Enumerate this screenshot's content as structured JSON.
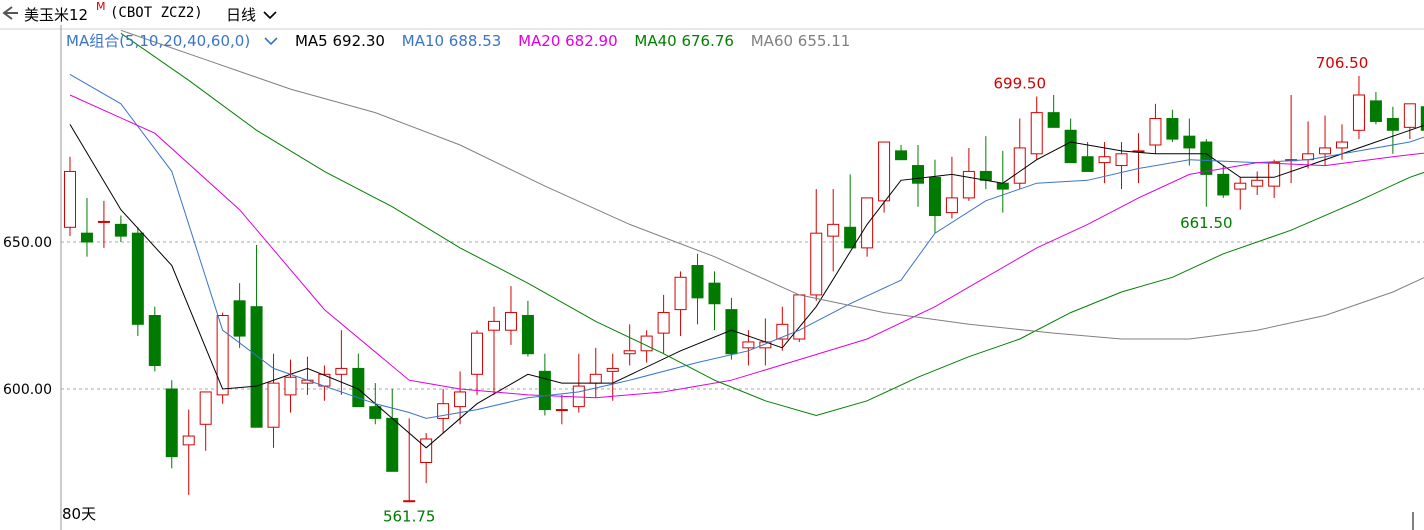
{
  "header": {
    "instrument": "美玉米12",
    "badge": "M",
    "code": "(CBOT ZCZ2)",
    "period": "日线"
  },
  "ma_legend": {
    "group_label": "MA组合(5,10,20,40,60,0)",
    "items": [
      {
        "label": "MA5 692.30",
        "color": "#000000"
      },
      {
        "label": "MA10 688.53",
        "color": "#3a74c9"
      },
      {
        "label": "MA20 682.90",
        "color": "#e000e0"
      },
      {
        "label": "MA40 676.76",
        "color": "#008000"
      },
      {
        "label": "MA60 655.11",
        "color": "#808080"
      }
    ]
  },
  "colors": {
    "up": "#d40000",
    "down": "#007a00",
    "grid": "#aaaaaa",
    "group": "#3a74c9"
  },
  "chart_data": {
    "type": "candlestick",
    "ylim": [
      548,
      715
    ],
    "yticks": [
      600.0,
      650.0
    ],
    "ytick_labels": [
      "600.00",
      "650.00"
    ],
    "days_label": "80天",
    "annotations": [
      {
        "text": "561.75",
        "index": 20,
        "value": 561.75,
        "position": "below",
        "color": "#007a00"
      },
      {
        "text": "699.50",
        "index": 56,
        "value": 699.5,
        "position": "above",
        "color": "#d40000"
      },
      {
        "text": "661.50",
        "index": 67,
        "value": 661.5,
        "position": "below",
        "color": "#007a00"
      },
      {
        "text": "706.50",
        "index": 75,
        "value": 706.5,
        "position": "above",
        "color": "#d40000"
      }
    ],
    "ohlc": [
      [
        655,
        679,
        652,
        674
      ],
      [
        653,
        665,
        645,
        650
      ],
      [
        657,
        664,
        648,
        657
      ],
      [
        656,
        659,
        650,
        652
      ],
      [
        653,
        655,
        618,
        622
      ],
      [
        625,
        628,
        606,
        608
      ],
      [
        600,
        603,
        573,
        577
      ],
      [
        581,
        593,
        564,
        584
      ],
      [
        588,
        598,
        579,
        599
      ],
      [
        598,
        626,
        595,
        625
      ],
      [
        630,
        636,
        614,
        618
      ],
      [
        628,
        649,
        602,
        587
      ],
      [
        587,
        612,
        580,
        602
      ],
      [
        598,
        610,
        592,
        604
      ],
      [
        602,
        611,
        598,
        603
      ],
      [
        601,
        608,
        596,
        605
      ],
      [
        605,
        620,
        598,
        607
      ],
      [
        607,
        612,
        596,
        594
      ],
      [
        594,
        602,
        588,
        590
      ],
      [
        590,
        600,
        580,
        572
      ],
      [
        562,
        590,
        562,
        562
      ],
      [
        575,
        585,
        568,
        583
      ],
      [
        590,
        600,
        585,
        595
      ],
      [
        594,
        606,
        588,
        599
      ],
      [
        605,
        620,
        598,
        619
      ],
      [
        620,
        628,
        598,
        623
      ],
      [
        620,
        635,
        615,
        626
      ],
      [
        625,
        630,
        611,
        612
      ],
      [
        606,
        612,
        591,
        593
      ],
      [
        593,
        598,
        588,
        593
      ],
      [
        594,
        612,
        592,
        601
      ],
      [
        602,
        614,
        597,
        605
      ],
      [
        606,
        612,
        596,
        607
      ],
      [
        612,
        622,
        608,
        613
      ],
      [
        613,
        620,
        609,
        618
      ],
      [
        619,
        632,
        612,
        626
      ],
      [
        627,
        640,
        618,
        638
      ],
      [
        642,
        646,
        622,
        631
      ],
      [
        636,
        640,
        620,
        629
      ],
      [
        627,
        631,
        610,
        612
      ],
      [
        614,
        620,
        608,
        616
      ],
      [
        614,
        624,
        608,
        616
      ],
      [
        617,
        628,
        613,
        622
      ],
      [
        617,
        632,
        616,
        632
      ],
      [
        632,
        668,
        630,
        653
      ],
      [
        652,
        668,
        640,
        656
      ],
      [
        655,
        673,
        654,
        648
      ],
      [
        648,
        662,
        645,
        665
      ],
      [
        664,
        684,
        660,
        684
      ],
      [
        681,
        683,
        678,
        678
      ],
      [
        676,
        683,
        662,
        670
      ],
      [
        672,
        678,
        653,
        659
      ],
      [
        660,
        679,
        658,
        665
      ],
      [
        665,
        682,
        664,
        674
      ],
      [
        674,
        686,
        668,
        671
      ],
      [
        670,
        681,
        660,
        668
      ],
      [
        670,
        692,
        668,
        682
      ],
      [
        680,
        699.5,
        678,
        694
      ],
      [
        694,
        700,
        690,
        689
      ],
      [
        688,
        692,
        677,
        677
      ],
      [
        679,
        684,
        675,
        674
      ],
      [
        677,
        684,
        670,
        679
      ],
      [
        676,
        684,
        668,
        680
      ],
      [
        681,
        687,
        670,
        681
      ],
      [
        683,
        697,
        680,
        692
      ],
      [
        692,
        695,
        684,
        685
      ],
      [
        686,
        692,
        676,
        682
      ],
      [
        684,
        685,
        662,
        673
      ],
      [
        673,
        676,
        665,
        666
      ],
      [
        668,
        672,
        661,
        670
      ],
      [
        669,
        674,
        666,
        671
      ],
      [
        669,
        678,
        665,
        677
      ],
      [
        678,
        700,
        670,
        678
      ],
      [
        678,
        691,
        675,
        680
      ],
      [
        680,
        693,
        676,
        682
      ],
      [
        682,
        690,
        678,
        684
      ],
      [
        688,
        706.5,
        685,
        700
      ],
      [
        698,
        701,
        690,
        691
      ],
      [
        692,
        696,
        680,
        688
      ],
      [
        689,
        697,
        685,
        697
      ],
      [
        696,
        700,
        681,
        688
      ],
      [
        688,
        699,
        687,
        687
      ]
    ],
    "ma": [
      {
        "name": "MA5",
        "color": "#000000",
        "points": [
          [
            0,
            690
          ],
          [
            3,
            661
          ],
          [
            6,
            642
          ],
          [
            9,
            600
          ],
          [
            11,
            601
          ],
          [
            14,
            607
          ],
          [
            17,
            600
          ],
          [
            19,
            590
          ],
          [
            21,
            580
          ],
          [
            24,
            595
          ],
          [
            27,
            605
          ],
          [
            29,
            602
          ],
          [
            32,
            602
          ],
          [
            36,
            613
          ],
          [
            39,
            620
          ],
          [
            42,
            614
          ],
          [
            44,
            628
          ],
          [
            47,
            656
          ],
          [
            49,
            671
          ],
          [
            52,
            673
          ],
          [
            55,
            670
          ],
          [
            57,
            678
          ],
          [
            59,
            684
          ],
          [
            62,
            681
          ],
          [
            64,
            680
          ],
          [
            67,
            680
          ],
          [
            69,
            672
          ],
          [
            71,
            672
          ],
          [
            73,
            676
          ],
          [
            76,
            682
          ],
          [
            79,
            688
          ],
          [
            80,
            690
          ],
          [
            81,
            690
          ]
        ]
      },
      {
        "name": "MA10",
        "color": "#3a74c9",
        "points": [
          [
            0,
            707
          ],
          [
            3,
            697
          ],
          [
            6,
            674
          ],
          [
            9,
            620
          ],
          [
            12,
            607
          ],
          [
            15,
            601
          ],
          [
            18,
            595
          ],
          [
            20,
            592
          ],
          [
            21,
            590
          ],
          [
            24,
            593
          ],
          [
            27,
            597
          ],
          [
            30,
            599
          ],
          [
            33,
            603
          ],
          [
            37,
            609
          ],
          [
            40,
            613
          ],
          [
            43,
            620
          ],
          [
            46,
            629
          ],
          [
            49,
            637
          ],
          [
            51,
            653
          ],
          [
            54,
            664
          ],
          [
            57,
            670
          ],
          [
            60,
            671
          ],
          [
            63,
            675
          ],
          [
            66,
            678
          ],
          [
            70,
            677
          ],
          [
            73,
            678
          ],
          [
            76,
            681
          ],
          [
            79,
            684
          ],
          [
            81,
            688
          ]
        ]
      },
      {
        "name": "MA20",
        "color": "#e000e0",
        "points": [
          [
            0,
            700
          ],
          [
            5,
            687
          ],
          [
            10,
            661
          ],
          [
            15,
            627
          ],
          [
            20,
            603
          ],
          [
            23,
            600
          ],
          [
            27,
            598
          ],
          [
            31,
            597
          ],
          [
            35,
            599
          ],
          [
            39,
            603
          ],
          [
            43,
            610
          ],
          [
            47,
            617
          ],
          [
            51,
            628
          ],
          [
            54,
            638
          ],
          [
            57,
            648
          ],
          [
            60,
            656
          ],
          [
            63,
            665
          ],
          [
            66,
            673
          ],
          [
            70,
            677
          ],
          [
            74,
            676
          ],
          [
            78,
            679
          ],
          [
            81,
            681
          ]
        ]
      },
      {
        "name": "MA40",
        "color": "#008000",
        "points": [
          [
            3,
            721
          ],
          [
            7,
            705
          ],
          [
            11,
            688
          ],
          [
            15,
            674
          ],
          [
            19,
            662
          ],
          [
            23,
            648
          ],
          [
            27,
            636
          ],
          [
            31,
            623
          ],
          [
            35,
            612
          ],
          [
            38,
            603
          ],
          [
            41,
            596
          ],
          [
            44,
            591
          ],
          [
            47,
            596
          ],
          [
            50,
            604
          ],
          [
            53,
            611
          ],
          [
            56,
            617
          ],
          [
            59,
            626
          ],
          [
            62,
            633
          ],
          [
            65,
            638
          ],
          [
            68,
            646
          ],
          [
            72,
            654
          ],
          [
            76,
            664
          ],
          [
            79,
            672
          ],
          [
            81,
            676
          ]
        ]
      },
      {
        "name": "MA60",
        "color": "#808080",
        "points": [
          [
            3,
            722
          ],
          [
            8,
            712
          ],
          [
            13,
            702
          ],
          [
            18,
            694
          ],
          [
            23,
            683
          ],
          [
            28,
            669
          ],
          [
            33,
            656
          ],
          [
            38,
            645
          ],
          [
            43,
            632
          ],
          [
            48,
            626
          ],
          [
            53,
            622
          ],
          [
            58,
            619
          ],
          [
            62,
            617
          ],
          [
            66,
            617
          ],
          [
            70,
            620
          ],
          [
            74,
            625
          ],
          [
            78,
            633
          ],
          [
            81,
            641
          ]
        ]
      }
    ]
  }
}
